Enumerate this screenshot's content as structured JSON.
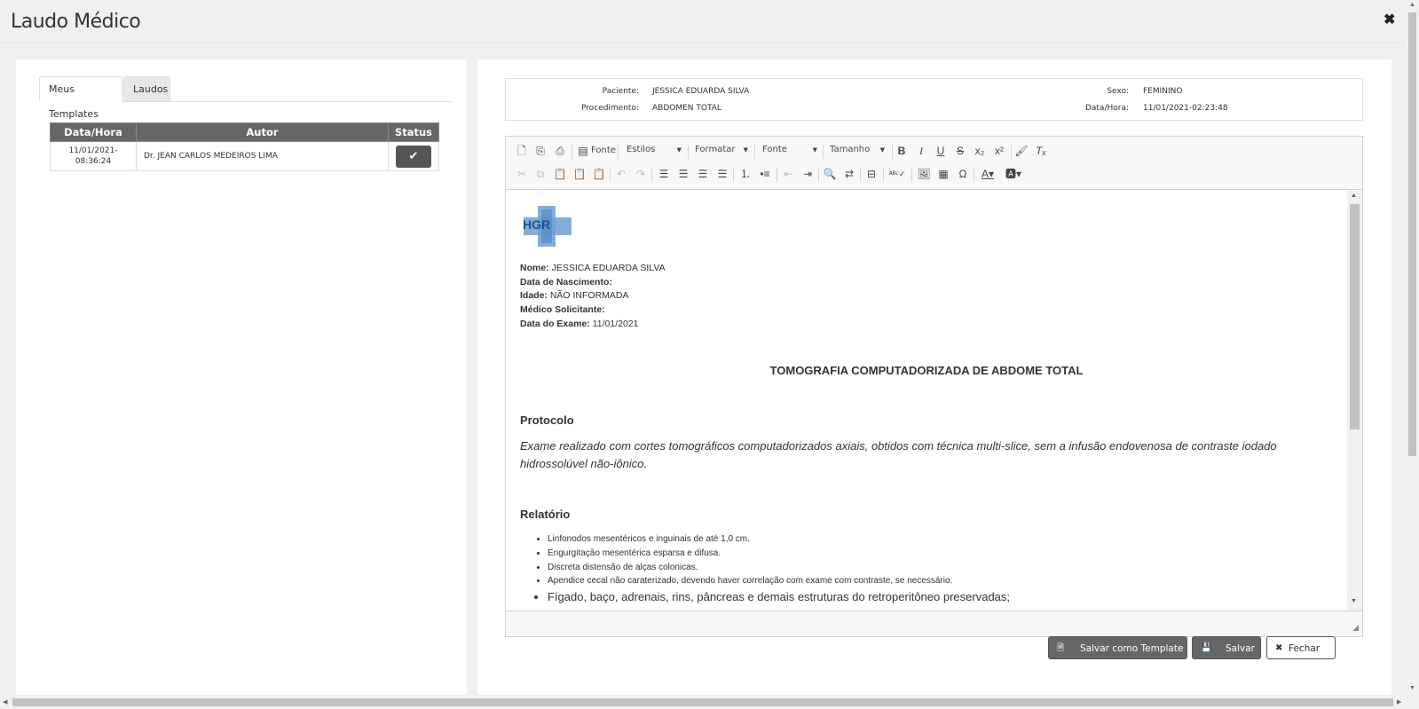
{
  "modal": {
    "title": "Laudo Médico",
    "close_glyph": "✖"
  },
  "tabs": [
    {
      "label": "Meus Templates",
      "active": true
    },
    {
      "label": "Laudos",
      "active": false
    }
  ],
  "templates_table": {
    "headers": [
      "Data/Hora",
      "Autor",
      "Status"
    ],
    "rows": [
      {
        "date": "11/01/2021-",
        "time": "08:36:24",
        "author": "Dr. JEAN CARLOS MEDEIROS LIMA",
        "status_icon": "check-icon"
      }
    ]
  },
  "patient_info": {
    "paciente_label": "Paciente:",
    "paciente": "JESSICA EDUARDA SILVA",
    "procedimento_label": "Procedimento:",
    "procedimento": "ABDOMEN TOTAL",
    "sexo_label": "Sexo:",
    "sexo": "FEMININO",
    "datahora_label": "Data/Hora:",
    "datahora": "11/01/2021-02:23:48"
  },
  "toolbar": {
    "fonte_button": "Fonte",
    "estilos": "Estilos",
    "formatar": "Formatar",
    "fonte": "Fonte",
    "tamanho": "Tamanho"
  },
  "document": {
    "logo_text": "HGR",
    "nome_label": "Nome:",
    "nome": "JESSICA EDUARDA SILVA",
    "nascimento_label": "Data de Nascimento:",
    "idade_label": "Idade:",
    "idade": "NÃO INFORMADA",
    "medico_label": "Médico Solicitante:",
    "exame_label": "Data do Exame:",
    "exame": "11/01/2021",
    "title": "TOMOGRAFIA COMPUTADORIZADA DE ABDOME TOTAL",
    "protocolo_heading": "Protocolo",
    "protocolo_text": "Exame realizado com cortes tomográficos computadorizados axiais, obtidos com técnica multi-slice, sem a infusão endovenosa de contraste iodado hidrossolúvel não-iônico.",
    "relatorio_heading": "Relatório",
    "relatorio_items": [
      "Linfonodos mesentéricos e inguinais de até 1,0 cm.",
      "Engurgitação mesentérica esparsa e difusa.",
      "Discreta distensão de alças colonicas.",
      "Apendice cecal não caraterizado, devendo haver correlação com exame com contraste, se necessário.",
      "Fígado, baço, adrenais, rins, pâncreas e demais estruturas do retroperitôneo preservadas;"
    ]
  },
  "buttons": {
    "save_template": "Salvar como Template",
    "save": "Salvar",
    "close": "Fechar"
  },
  "colors": {
    "table_header": "#666666",
    "button_dark": "#666666",
    "panel": "#ffffff",
    "background": "#f0f0f0"
  }
}
